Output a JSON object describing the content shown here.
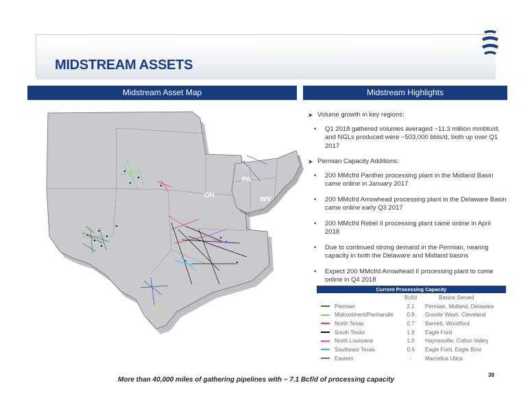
{
  "header": {
    "title": "MIDSTREAM ASSETS",
    "page_number": "38"
  },
  "sections": {
    "left_title": "Midstream Asset Map",
    "right_title": "Midstream Highlights"
  },
  "map": {
    "state_labels": [
      "PA",
      "OH",
      "WV"
    ],
    "colors": {
      "land": "#c8cacd",
      "land_edge": "#6b6e73",
      "shadow": "#7a7d82"
    }
  },
  "highlights": {
    "groups": [
      {
        "heading": "Volume growth in key regions:",
        "bullets": [
          "Q1 2018 gathered volumes averaged ~11.3 million mmbtu/d, and NGLs produced were ~503,000 bbls/d, both up over Q1 2017"
        ]
      },
      {
        "heading": "Permian Capacity Additions:",
        "bullets": [
          "200 MMcf/d Panther processing plant in the Midland Basin came online in January 2017",
          "200 MMcf/d Arrowhead processing plant in the Delaware Basin came online early Q3 2017",
          "200 MMcf/d Rebel II processing plant came online in April 2018",
          "Due to continued strong demand in the Permian, nearing capacity in both the Delaware and Midland basins",
          "Expect 200 MMcf/d Arrowhead II processing plant to come online in Q4 2018"
        ]
      }
    ]
  },
  "capacity_table": {
    "title": "Current Processing Capacity",
    "col_value": "Bcf/d",
    "col_basins": "Basins Served",
    "rows": [
      {
        "name": "Permian",
        "value": "2.1",
        "basins": "Permian, Midland, Delaware",
        "color": "#2e7d32"
      },
      {
        "name": "Midcontinent/Panhandle",
        "value": "0.9",
        "basins": "Granite Wash, Cleveland",
        "color": "#7ddc5a"
      },
      {
        "name": "North Texas",
        "value": "0.7",
        "basins": "Barnett, Woodford",
        "color": "#e53935"
      },
      {
        "name": "South Texas",
        "value": "1.9",
        "basins": "Eagle Ford",
        "color": "#111111"
      },
      {
        "name": "North Louisiana",
        "value": "1.0",
        "basins": "Haynesville, Cotton Valley",
        "color": "#e040fb"
      },
      {
        "name": "Southeast Texas",
        "value": "0.4",
        "basins": "Eagle Ford, Eagle Bine",
        "color": "#29b6f6"
      },
      {
        "name": "Eastern",
        "value": "-",
        "basins": "Marcellus Utica",
        "color": "#7e57c2"
      }
    ]
  },
  "footer": {
    "text": "More than 40,000 miles of gathering pipelines with ~ 7.1 Bcf/d of processing capacity"
  },
  "theme": {
    "navy": "#163c82",
    "title_blue": "#173a8e"
  }
}
